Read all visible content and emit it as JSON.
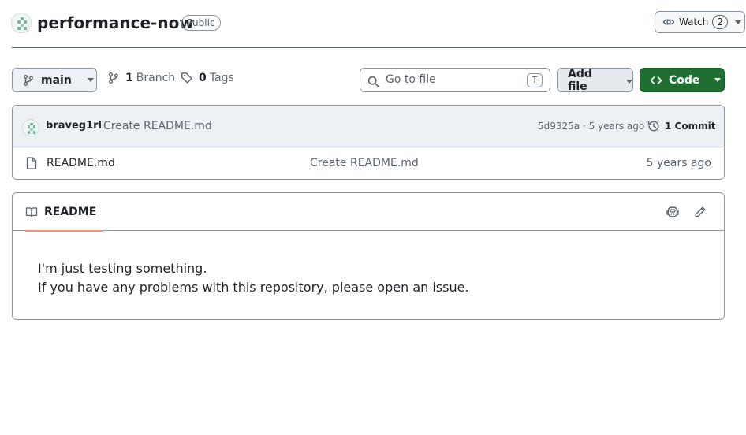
{
  "repo": {
    "name": "performance-now",
    "visibility": "Public"
  },
  "watch": {
    "label": "Watch",
    "count": "2"
  },
  "toolbar": {
    "branch": "main",
    "branch_count": "1",
    "branch_label": "Branch",
    "tag_count": "0",
    "tag_label": "Tags",
    "search_placeholder": "Go to file",
    "search_shortcut": "T",
    "add_file_label": "Add file",
    "code_label": "Code"
  },
  "latest_commit": {
    "author": "braveg1rl",
    "message": "Create README.md",
    "meta": "5d9325a · 5 years ago",
    "history": "1 Commit"
  },
  "files": [
    {
      "name": "README.md",
      "commit": "Create README.md",
      "age": "5 years ago",
      "icon": "file-icon"
    }
  ],
  "readme": {
    "tab_label": "README",
    "lines": [
      "I'm just testing something.",
      "If you have any problems with this repository, please open an issue."
    ]
  },
  "colors": {
    "code_button": "#1f6f32",
    "tab_underline": "#fd8c73",
    "muted_text": "#59636e",
    "border": "#8c959f"
  }
}
